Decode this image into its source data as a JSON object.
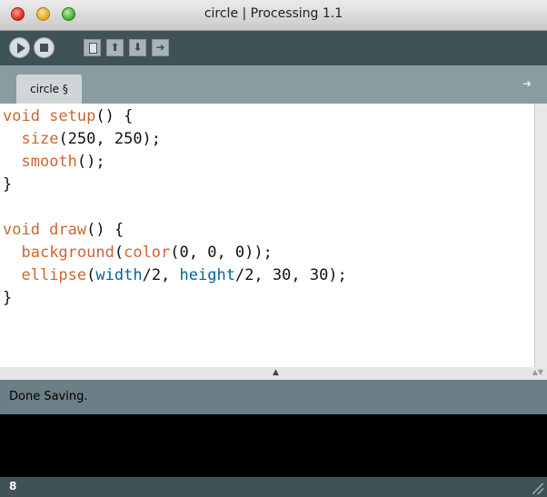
{
  "window": {
    "title": "circle | Processing 1.1"
  },
  "toolbar": {
    "buttons": [
      {
        "name": "run",
        "icon": "play-icon"
      },
      {
        "name": "stop",
        "icon": "stop-icon"
      },
      {
        "name": "new",
        "icon": "new-file-icon"
      },
      {
        "name": "open",
        "icon": "open-arrow-up-icon",
        "glyph": "⬆"
      },
      {
        "name": "save",
        "icon": "save-arrow-down-icon",
        "glyph": "⬇"
      },
      {
        "name": "export",
        "icon": "export-arrow-icon",
        "glyph": "➜"
      }
    ]
  },
  "tabs": {
    "active_label": "circle §",
    "menu_glyph": "➜"
  },
  "editor": {
    "lines": [
      [
        {
          "t": "void setup",
          "c": "kw"
        },
        {
          "t": "() {",
          "c": ""
        }
      ],
      [
        {
          "t": "  ",
          "c": ""
        },
        {
          "t": "size",
          "c": "kw"
        },
        {
          "t": "(250, 250);",
          "c": ""
        }
      ],
      [
        {
          "t": "  ",
          "c": ""
        },
        {
          "t": "smooth",
          "c": "kw"
        },
        {
          "t": "();",
          "c": ""
        }
      ],
      [
        {
          "t": "}",
          "c": ""
        }
      ],
      [
        {
          "t": "",
          "c": ""
        }
      ],
      [
        {
          "t": "void draw",
          "c": "kw"
        },
        {
          "t": "() {",
          "c": ""
        }
      ],
      [
        {
          "t": "  ",
          "c": ""
        },
        {
          "t": "background",
          "c": "kw"
        },
        {
          "t": "(",
          "c": ""
        },
        {
          "t": "color",
          "c": "kw"
        },
        {
          "t": "(0, 0, 0));",
          "c": ""
        }
      ],
      [
        {
          "t": "  ",
          "c": ""
        },
        {
          "t": "ellipse",
          "c": "kw"
        },
        {
          "t": "(",
          "c": ""
        },
        {
          "t": "width",
          "c": "fn"
        },
        {
          "t": "/2, ",
          "c": ""
        },
        {
          "t": "height",
          "c": "fn"
        },
        {
          "t": "/2, 30, 30);",
          "c": ""
        }
      ],
      [
        {
          "t": "}",
          "c": ""
        }
      ]
    ]
  },
  "status": {
    "message": "Done Saving."
  },
  "footer": {
    "line_number": "8"
  },
  "colors": {
    "keyword": "#cc6633",
    "builtin_variable": "#006699",
    "toolbar_bg": "#3f5258",
    "tabbar_bg": "#889ca2",
    "status_bg": "#6d7f86",
    "console_bg": "#000000"
  }
}
